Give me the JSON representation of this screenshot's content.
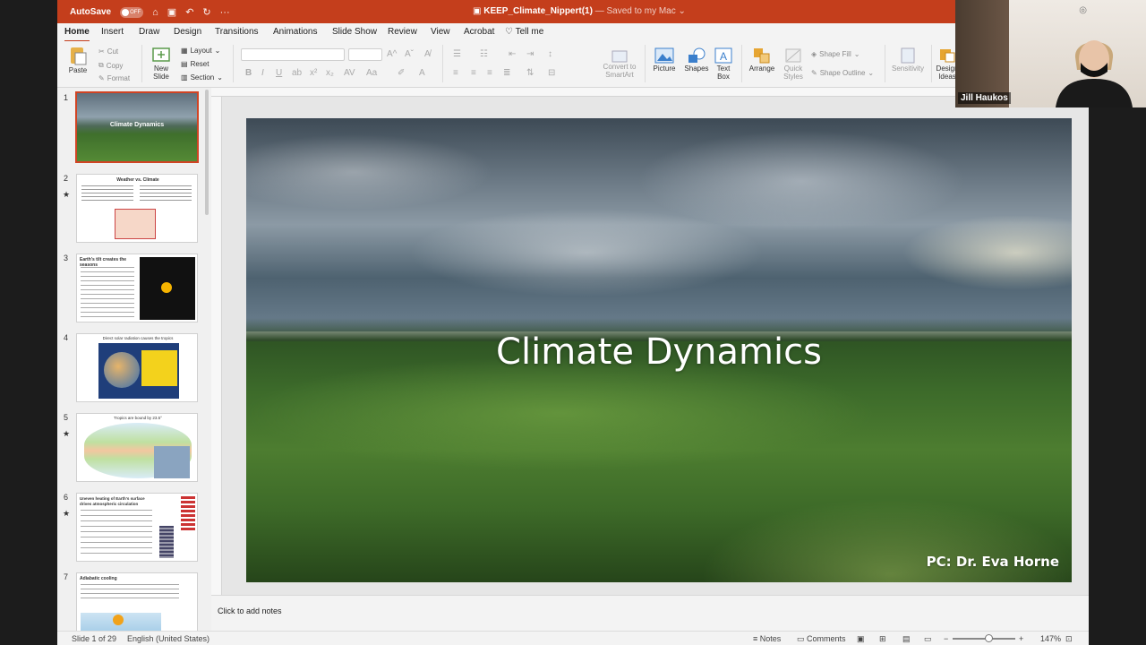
{
  "titlebar": {
    "autosave_label": "AutoSave",
    "autosave_state": "OFF",
    "document_name": "KEEP_Climate_Nippert(1)",
    "saved_status": "— Saved to my Mac ⌄"
  },
  "menu": {
    "tabs": [
      "Home",
      "Insert",
      "Draw",
      "Design",
      "Transitions",
      "Animations",
      "Slide Show",
      "Review",
      "View",
      "Acrobat"
    ],
    "tell_me": "Tell me"
  },
  "ribbon": {
    "paste": "Paste",
    "cut": "Cut",
    "copy": "Copy",
    "format": "Format",
    "new_slide": "New\nSlide",
    "layout": "Layout",
    "reset": "Reset",
    "section": "Section",
    "convert_smartart": "Convert to\nSmartArt",
    "picture": "Picture",
    "shapes": "Shapes",
    "text_box": "Text\nBox",
    "arrange": "Arrange",
    "quick_styles": "Quick\nStyles",
    "shape_fill": "Shape Fill",
    "shape_outline": "Shape Outline",
    "sensitivity": "Sensitivity",
    "design_ideas": "Design\nIdeas"
  },
  "thumbnails": [
    {
      "number": "1",
      "star": "",
      "caption": "Climate Dynamics"
    },
    {
      "number": "2",
      "star": "★",
      "caption": "Weather vs. Climate"
    },
    {
      "number": "3",
      "star": "",
      "caption": "Earth's tilt creates the seasons"
    },
    {
      "number": "4",
      "star": "",
      "caption": "Direct solar radiation causes the tropics"
    },
    {
      "number": "5",
      "star": "★",
      "caption": "Tropics are bound by 23.5°"
    },
    {
      "number": "6",
      "star": "★",
      "caption": "Uneven heating of Earth's surface drives atmospheric circulation"
    },
    {
      "number": "7",
      "star": "",
      "caption": "Adiabatic cooling"
    }
  ],
  "slide": {
    "title": "Climate Dynamics",
    "credit": "PC: Dr. Eva Horne"
  },
  "notes": {
    "placeholder": "Click to add notes"
  },
  "status": {
    "slide_position": "Slide 1 of 29",
    "language": "English (United States)",
    "notes": "Notes",
    "comments": "Comments",
    "zoom": "147%"
  },
  "video": {
    "participant_name": "Jill Haukos"
  },
  "colors": {
    "accent": "#c43e1c",
    "thumbnail_selected": "#d14424"
  }
}
